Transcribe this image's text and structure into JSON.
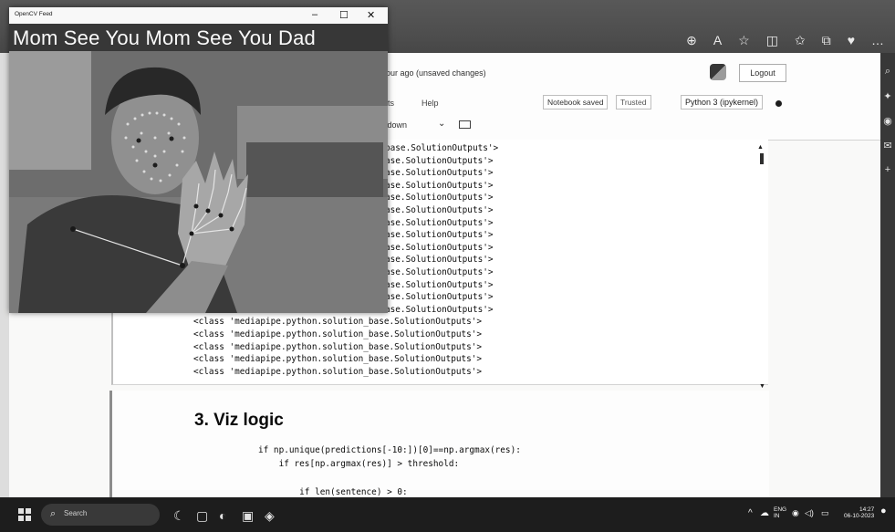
{
  "camera_window": {
    "title": "OpenCV Feed",
    "controls": [
      "–",
      "☐",
      "✕"
    ],
    "banner_text": "Mom See You Mom See You Dad"
  },
  "notebook": {
    "status": "hour ago  (unsaved changes)",
    "logout_label": "Logout",
    "menu": [
      "nts",
      "Help"
    ],
    "notebook_saved": "Notebook saved",
    "trusted": "Trusted",
    "kernel": "Python 3 (ipykernel)",
    "cell_type_dropdown": "kdown"
  },
  "output_lines_partial": [
    "base.SolutionOutputs'>",
    "ase.SolutionOutputs'>",
    "ase.SolutionOutputs'>",
    "ase.SolutionOutputs'>",
    "ase.SolutionOutputs'>",
    "ase.SolutionOutputs'>",
    "ase.SolutionOutputs'>",
    "ase.SolutionOutputs'>",
    "ase.SolutionOutputs'>",
    "ase.SolutionOutputs'>",
    "ase.SolutionOutputs'>",
    "ase.SolutionOutputs'>",
    "ase.SolutionOutputs'>",
    "ase.SolutionOutputs'>"
  ],
  "output_lines_full": [
    "<class 'mediapipe.python.solution_base.SolutionOutputs'>",
    "<class 'mediapipe.python.solution_base.SolutionOutputs'>",
    "<class 'mediapipe.python.solution_base.SolutionOutputs'>",
    "<class 'mediapipe.python.solution_base.SolutionOutputs'>",
    "<class 'mediapipe.python.solution_base.SolutionOutputs'>"
  ],
  "markdown_heading": "3. Viz logic",
  "code_lines": [
    "if np.unique(predictions[-10:])[0]==np.argmax(res):",
    "    if res[np.argmax(res)] > threshold:",
    "        if len(sentence) > 0:"
  ],
  "taskbar": {
    "search_label": "Search",
    "lang": "ENG",
    "region": "IN",
    "time": "14:27",
    "date": "06-10-2023"
  },
  "colors": {
    "taskbar": "#222222",
    "browser_chrome": "#4a4a4a",
    "page_bg": "#f3f3f1"
  }
}
